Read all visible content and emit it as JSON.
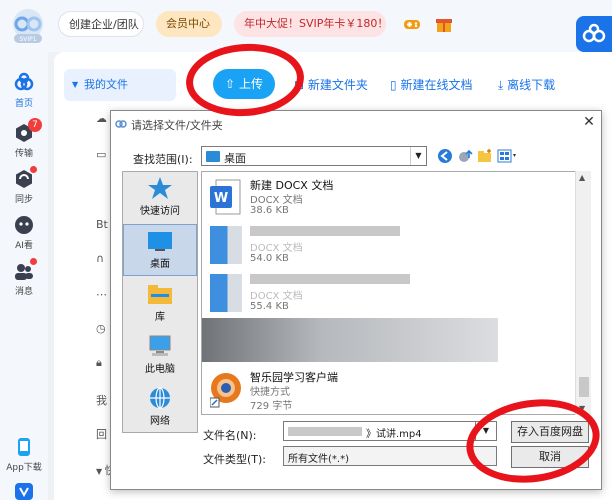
{
  "app": {
    "logo_text": "SVIP1",
    "team_pill": "创建企业/团队",
    "vip_pill": "会员中心",
    "promo_pill": "年中大促！SVIP年卡￥180！",
    "sidebar": [
      {
        "label": "首页",
        "icon": "home-icon",
        "active": true
      },
      {
        "label": "传输",
        "icon": "transfer-icon",
        "badge": "7"
      },
      {
        "label": "同步",
        "icon": "sync-icon",
        "dot": true
      },
      {
        "label": "AI看",
        "icon": "ai-icon"
      },
      {
        "label": "消息",
        "icon": "message-icon",
        "dot": true
      }
    ],
    "app_download": "App下载",
    "my_files": "我的文件",
    "upload": "上传",
    "new_folder": "新建文件夹",
    "new_online_doc": "新建在线文档",
    "offline_download": "离线下载",
    "tree_fragments": [
      "Bt",
      "我",
      "回",
      "快"
    ]
  },
  "dialog": {
    "title": "请选择文件/文件夹",
    "look_in_label": "查找范围(I):",
    "look_in_value": "桌面",
    "places": [
      {
        "label": "快速访问",
        "icon": "star-icon"
      },
      {
        "label": "桌面",
        "icon": "desktop-icon",
        "selected": true
      },
      {
        "label": "库",
        "icon": "library-icon"
      },
      {
        "label": "此电脑",
        "icon": "computer-icon"
      },
      {
        "label": "网络",
        "icon": "network-icon"
      }
    ],
    "files": [
      {
        "name": "新建 DOCX 文档",
        "type": "DOCX 文档",
        "size": "38.6 KB"
      },
      {
        "name": "",
        "type": "DOCX 文档",
        "size": "54.0 KB"
      },
      {
        "name": "",
        "type": "DOCX 文档",
        "size": "55.4 KB"
      },
      {
        "name": "智乐园学习客户端",
        "type": "快捷方式",
        "size": "729 字节"
      }
    ],
    "filename_label": "文件名(N):",
    "filename_value": "》试讲.mp4",
    "filetype_label": "文件类型(T):",
    "filetype_value": "所有文件(*.*)",
    "save_button": "存入百度网盘",
    "cancel_button": "取消"
  },
  "colors": {
    "accent": "#1a73e8",
    "upload": "#1aa3f5",
    "annotation": "#e8141b"
  }
}
